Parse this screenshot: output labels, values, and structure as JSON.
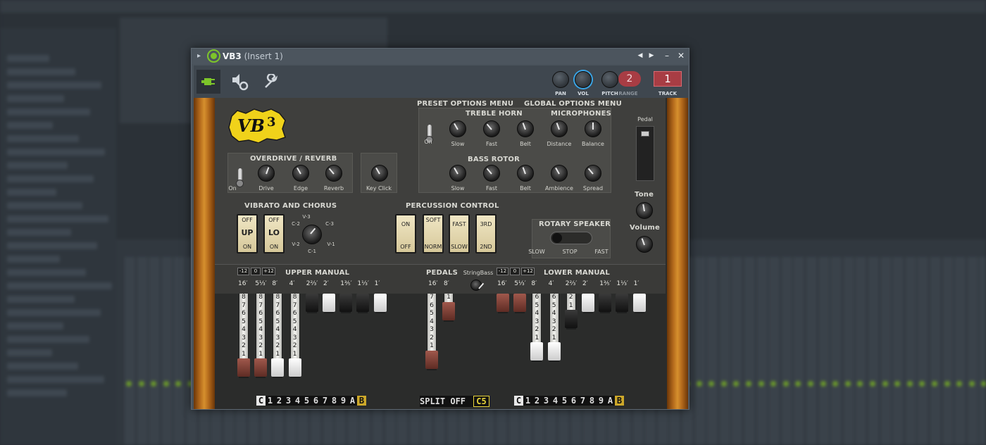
{
  "window": {
    "title": "VB3",
    "insert": "(Insert 1)",
    "prev": "◀",
    "next": "▶",
    "minimize": "–",
    "close": "✕"
  },
  "toolbar": {
    "pan_label": "PAN",
    "vol_label": "VOL",
    "pitch_label": "PITCH",
    "range_label": "RANGE",
    "pitch_value": "2",
    "track_label": "TRACK",
    "track_value": "1"
  },
  "logo_text": "VB3",
  "menus": {
    "preset": "PRESET OPTIONS MENU",
    "global": "GLOBAL OPTIONS MENU"
  },
  "overdrive": {
    "title": "OVERDRIVE / REVERB",
    "toggle": "On",
    "knobs": [
      "Drive",
      "Edge",
      "Reverb"
    ]
  },
  "key_click": "Key Click",
  "treble_horn": {
    "title": "TREBLE HORN",
    "toggle": "On",
    "knobs": [
      "Slow",
      "Fast",
      "Belt"
    ]
  },
  "microphones": {
    "title": "MICROPHONES",
    "knobs": [
      "Distance",
      "Balance"
    ]
  },
  "bass_rotor": {
    "title": "BASS ROTOR",
    "knobs": [
      "Slow",
      "Fast",
      "Belt",
      "Ambience",
      "Spread"
    ]
  },
  "pedal_label": "Pedal",
  "tone_label": "Tone",
  "volume_label": "Volume",
  "vibrato": {
    "title": "VIBRATO AND CHORUS",
    "buttons": [
      {
        "top": "OFF",
        "mid": "UP",
        "bot": "ON"
      },
      {
        "top": "OFF",
        "mid": "LO",
        "bot": "ON"
      }
    ],
    "dial": [
      "V-3",
      "C-3",
      "V-1",
      "C-1",
      "V-2",
      "C-2"
    ]
  },
  "percussion": {
    "title": "PERCUSSION CONTROL",
    "buttons": [
      {
        "top": "ON",
        "bot": "OFF"
      },
      {
        "top": "SOFT",
        "bot": "NORM"
      },
      {
        "top": "FAST",
        "bot": "SLOW"
      },
      {
        "top": "3RD",
        "bot": "2ND"
      }
    ]
  },
  "rotary": {
    "title": "ROTARY SPEAKER",
    "slow": "SLOW",
    "stop": "STOP",
    "fast": "FAST"
  },
  "upper_manual": {
    "title": "UPPER MANUAL",
    "transpose": [
      "-12",
      "0",
      "+12"
    ],
    "footages": [
      "16′",
      "5⅓′",
      "8′",
      "4′",
      "2⅔′",
      "2′",
      "1⅗′",
      "1⅓′",
      "1′"
    ],
    "drawbars": [
      8,
      8,
      8,
      8,
      0,
      0,
      0,
      0,
      0
    ]
  },
  "pedals": {
    "title": "PEDALS",
    "sub": "StringBass",
    "footages": [
      "16′",
      "8′"
    ],
    "drawbars": [
      7,
      1
    ]
  },
  "lower_manual": {
    "title": "LOWER MANUAL",
    "transpose": [
      "-12",
      "0",
      "+12"
    ],
    "footages": [
      "16′",
      "5⅓′",
      "8′",
      "4′",
      "2⅔′",
      "2′",
      "1⅗′",
      "1⅓′",
      "1′"
    ],
    "drawbars": [
      0,
      0,
      6,
      6,
      2,
      0,
      0,
      0,
      0
    ]
  },
  "presets_upper": [
    "C",
    "1",
    "2",
    "3",
    "4",
    "5",
    "6",
    "7",
    "8",
    "9",
    "A",
    "B"
  ],
  "presets_lower": [
    "C",
    "1",
    "2",
    "3",
    "4",
    "5",
    "6",
    "7",
    "8",
    "9",
    "A",
    "B"
  ],
  "split": {
    "label": "SPLIT OFF",
    "note": "C5"
  },
  "colors": {
    "accent_green": "#7dc52a",
    "track_red": "#a83d44",
    "wood": "#d6902e"
  }
}
